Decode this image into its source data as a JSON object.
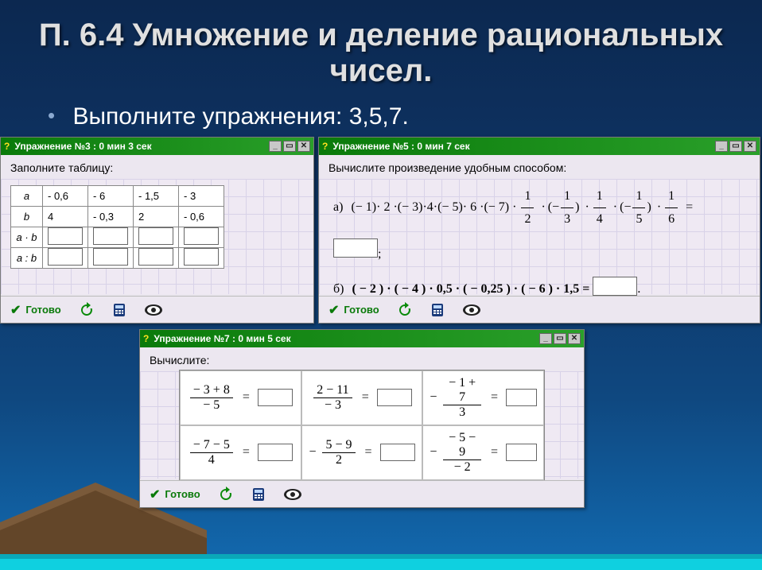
{
  "slide": {
    "title": "П. 6.4 Умножение и деление рациональных чисел.",
    "subtitle": "Выполните упражнения: 3,5,7."
  },
  "ex3": {
    "titlebar": "Упражнение №3 : 0 мин  3 сек",
    "prompt": "Заполните таблицу:",
    "headers": {
      "r1": "a",
      "r2": "b",
      "r3": "a · b",
      "r4": "a : b"
    },
    "rows": {
      "a": [
        "- 0,6",
        "- 6",
        "- 1,5",
        "- 3"
      ],
      "b": [
        "4",
        "- 0,3",
        "2",
        "- 0,6"
      ]
    }
  },
  "ex5": {
    "titlebar": "Упражнение №5 : 0 мин  7 сек",
    "prompt": "Вычислите произведение удобным способом:",
    "a_label": "а)",
    "a_lead": "(− 1)· 2 ·(− 3)·4·(− 5)· 6 ·(− 7) ·",
    "a_fracs": [
      {
        "num": "1",
        "den": "2"
      },
      {
        "num": "1",
        "den": "3",
        "neg": true
      },
      {
        "num": "1",
        "den": "4"
      },
      {
        "num": "1",
        "den": "5",
        "neg": true
      },
      {
        "num": "1",
        "den": "6"
      }
    ],
    "b_label": "б)",
    "b_expr": "( − 2 ) · ( − 4 ) · 0,5 · ( − 0,25 ) · ( − 6 ) · 1,5 ="
  },
  "ex7": {
    "titlebar": "Упражнение №7 : 0 мин  5 сек",
    "prompt": "Вычислите:",
    "cells": [
      {
        "pre": "",
        "num": "− 3 + 8",
        "den": "− 5"
      },
      {
        "pre": "",
        "num": "2 − 11",
        "den": "− 3"
      },
      {
        "pre": "−",
        "num": "− 1 + 7",
        "den": "3"
      },
      {
        "pre": "",
        "num": "− 7 − 5",
        "den": "4"
      },
      {
        "pre": "−",
        "num": "5 − 9",
        "den": "2"
      },
      {
        "pre": "−",
        "num": "− 5 − 9",
        "den": "− 2"
      }
    ]
  },
  "toolbar": {
    "ready": "Готово"
  },
  "winbtns": {
    "min": "_",
    "max": "▭",
    "close": "✕"
  }
}
